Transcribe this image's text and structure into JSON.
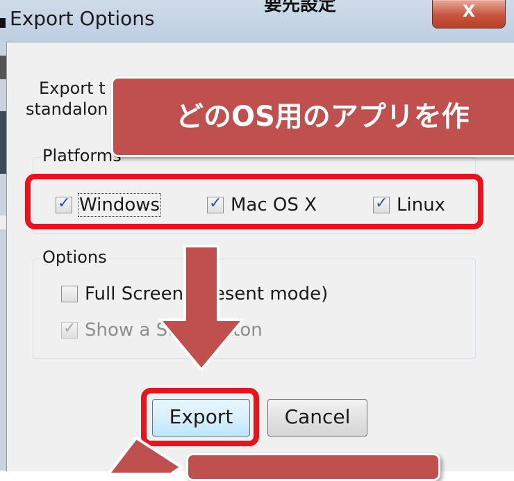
{
  "window": {
    "title": "Export Options",
    "close_glyph": "X",
    "top_cut_text": "要先設定"
  },
  "dialog": {
    "description_line1": "Export t",
    "description_line2": "standalon",
    "platforms": {
      "label": "Platforms",
      "items": [
        {
          "label": "Windows",
          "checked": true
        },
        {
          "label": "Mac OS X",
          "checked": true
        },
        {
          "label": "Linux",
          "checked": true
        }
      ]
    },
    "options": {
      "label": "Options",
      "fullscreen": {
        "label": "Full Screen (Present mode)",
        "checked": false
      },
      "show_stop": {
        "label": "Show a Stop button",
        "checked": true,
        "enabled": false
      }
    },
    "buttons": {
      "export": "Export",
      "cancel": "Cancel"
    }
  },
  "annotations": {
    "banner_text": "どのOS用のアプリを作",
    "highlight_color": "#e8141b",
    "banner_color": "#c0504d",
    "arrow_color": "#c0504d"
  }
}
